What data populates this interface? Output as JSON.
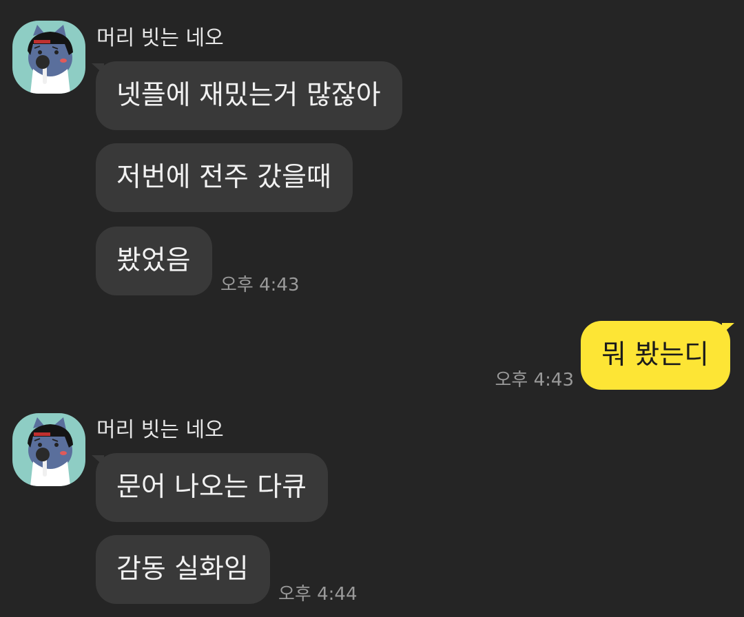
{
  "messages": [
    {
      "sender": "머리 빗는 네오",
      "avatar_icon": "neo-avatar-icon",
      "lines": [
        "넷플에 재밌는거 많잖아",
        "저번에 전주 갔을때",
        "봤었음"
      ],
      "time": "오후 4:43"
    },
    {
      "mine": true,
      "lines": [
        "뭐 봤는디"
      ],
      "time": "오후 4:43"
    },
    {
      "sender": "머리 빗는 네오",
      "avatar_icon": "neo-avatar-icon",
      "lines": [
        "문어 나오는 다큐",
        "감동 실화임"
      ],
      "time": "오후 4:44"
    }
  ],
  "colors": {
    "background": "#252525",
    "incoming_bubble": "#393939",
    "outgoing_bubble": "#fde535",
    "avatar_bg": "#8ecdc4"
  }
}
